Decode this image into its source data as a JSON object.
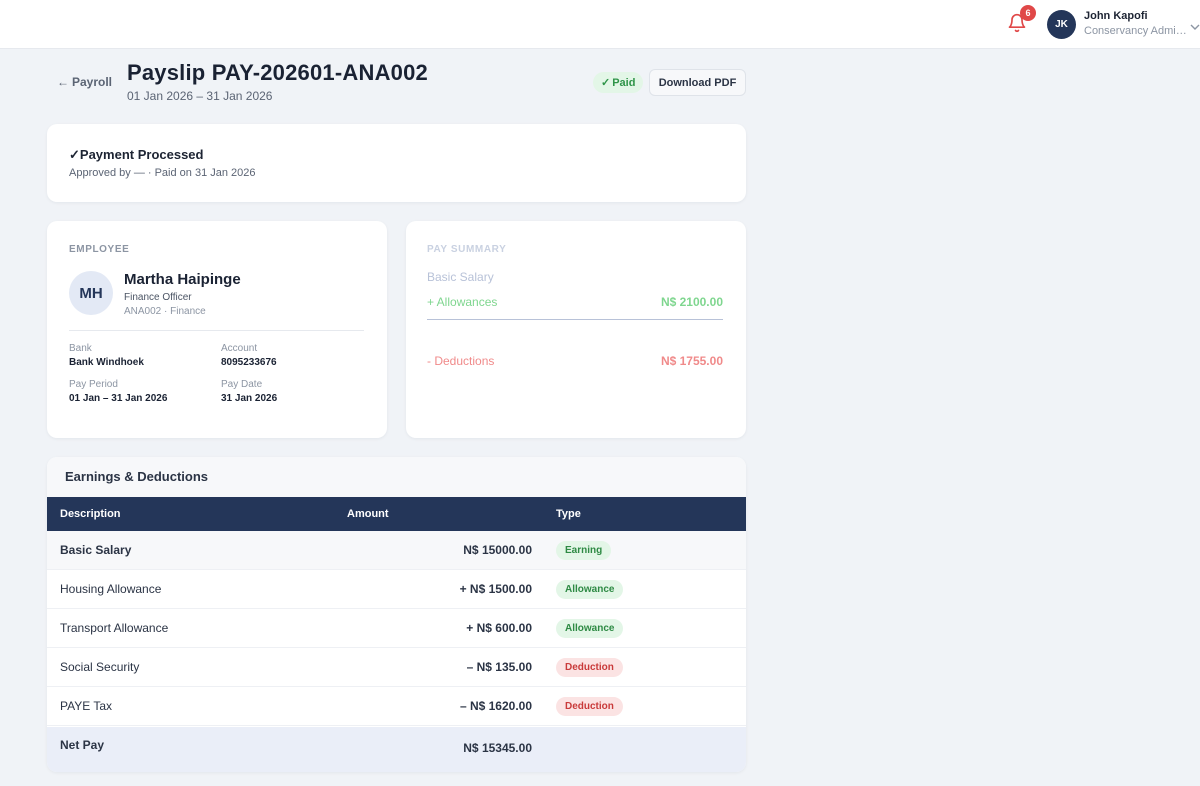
{
  "header": {
    "notifications_count": "6",
    "user_initials": "JK",
    "user_name": "John Kapofi",
    "user_role": "Conservancy Administrator"
  },
  "page": {
    "back_label": "Payroll",
    "title": "Payslip PAY-202601-ANA002",
    "period": "01 Jan 2026 – 31 Jan 2026",
    "status_badge": "Paid",
    "download_label": "Download PDF"
  },
  "status_card": {
    "title": "Payment Processed",
    "subtitle": "Approved by — · Paid on 31 Jan 2026"
  },
  "employee": {
    "section_label": "EMPLOYEE",
    "initials": "MH",
    "name": "Martha Haipinge",
    "role": "Finance Officer",
    "id_dept": "ANA002 · Finance",
    "bank_label": "Bank",
    "bank_value": "Bank Windhoek",
    "account_label": "Account",
    "account_value": "8095233676",
    "pay_period_label": "Pay Period",
    "pay_period_value": "01 Jan – 31 Jan 2026",
    "pay_date_label": "Pay Date",
    "pay_date_value": "31 Jan 2026"
  },
  "summary": {
    "section_label": "PAY SUMMARY",
    "basic_label": "Basic Salary",
    "allowances_label": "+ Allowances",
    "allowances_value": "N$ 2100.00",
    "deductions_label": "- Deductions",
    "deductions_value": "N$ 1755.00"
  },
  "table": {
    "title": "Earnings & Deductions",
    "columns": [
      "Description",
      "Amount",
      "Type"
    ],
    "rows": [
      {
        "description": "Basic Salary",
        "amount": "N$ 15000.00",
        "type": "Earning"
      },
      {
        "description": "Housing Allowance",
        "amount": "+ N$ 1500.00",
        "type": "Allowance"
      },
      {
        "description": "Transport Allowance",
        "amount": "+ N$ 600.00",
        "type": "Allowance"
      },
      {
        "description": "Social Security",
        "amount": "– N$ 135.00",
        "type": "Deduction"
      },
      {
        "description": "PAYE Tax",
        "amount": "– N$ 1620.00",
        "type": "Deduction"
      }
    ],
    "net_label": "Net Pay",
    "net_value": "N$ 15345.00"
  },
  "colors": {
    "navy": "#243659",
    "green": "#2e9448",
    "red": "#e04848",
    "summary_green": "#7fd68f",
    "summary_red": "#f08a8a"
  }
}
